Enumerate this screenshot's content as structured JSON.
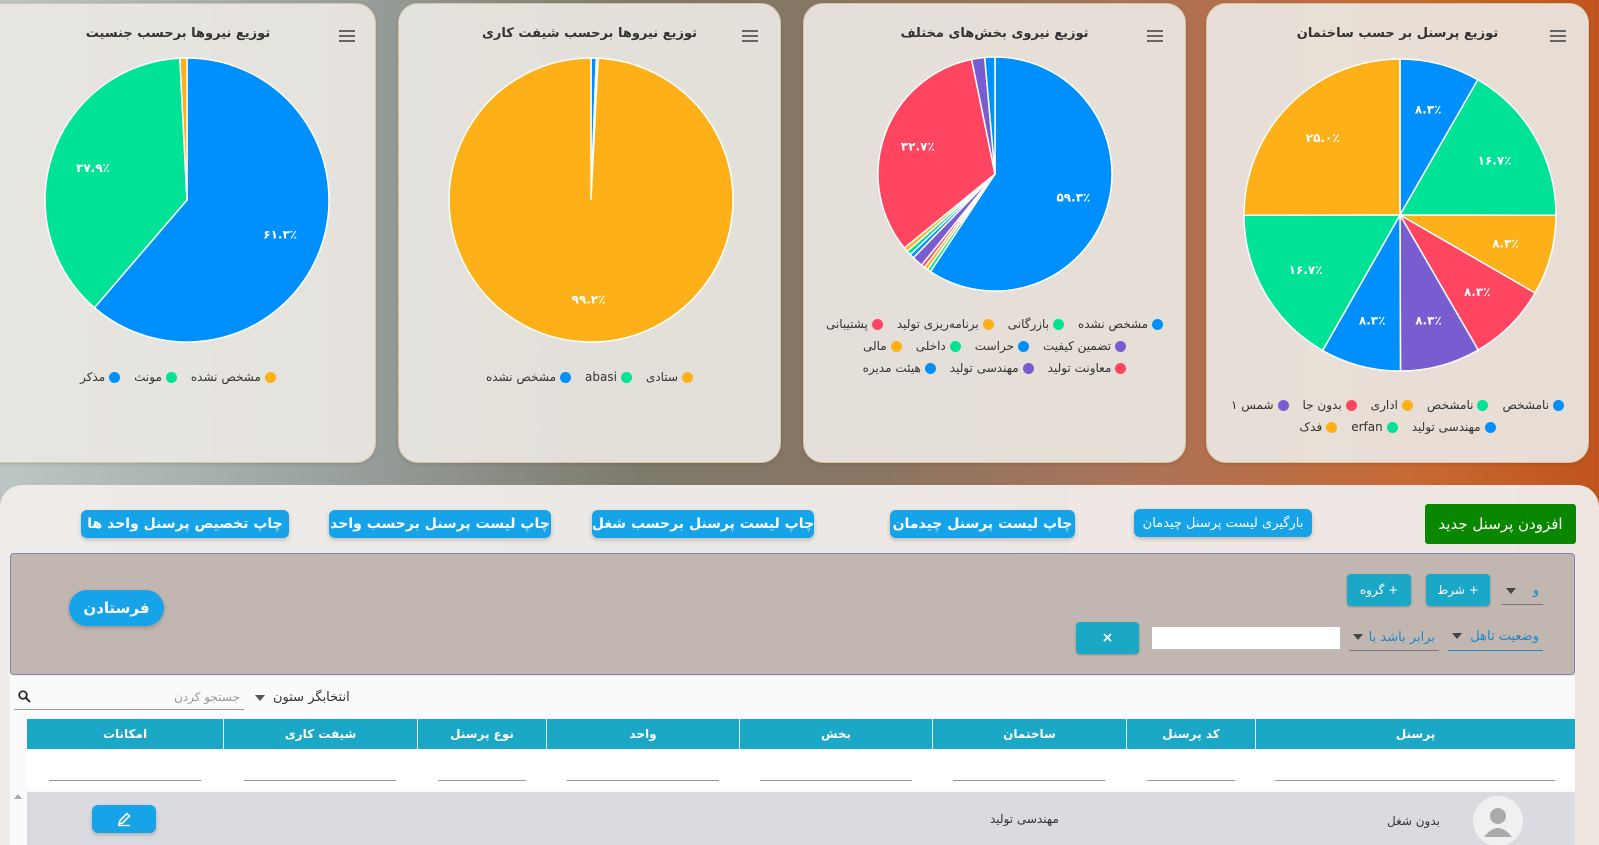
{
  "charts": [
    {
      "title": "توزیع نیروها برحسب جنسیت",
      "chart_data": {
        "type": "pie",
        "slices": [
          {
            "label": "مذکر",
            "value": 61.3,
            "color": "#0090fe",
            "text": "۶۱.۳٪"
          },
          {
            "label": "مونث",
            "value": 37.9,
            "color": "#00e396",
            "text": "۳۷.۹٪"
          },
          {
            "label": "مشخص نشده",
            "value": 0.8,
            "color": "#feb019",
            "text": ""
          }
        ]
      }
    },
    {
      "title": "توزیع نیروها برحسب شیفت کاری",
      "chart_data": {
        "type": "pie",
        "slices": [
          {
            "label": "مشخص نشده",
            "value": 0.6,
            "color": "#0090fe",
            "text": ""
          },
          {
            "label": "abasi",
            "value": 0.2,
            "color": "#00e396",
            "text": ""
          },
          {
            "label": "ستادی",
            "value": 99.2,
            "color": "#feb019",
            "text": "۹۹.۲٪"
          }
        ]
      }
    },
    {
      "title": "توزیع نیروی بخش‌های مختلف",
      "chart_data": {
        "type": "pie",
        "slices": [
          {
            "label": "مشخص نشده",
            "value": 59.3,
            "color": "#0090fe",
            "text": "۵۹.۳٪"
          },
          {
            "label": "بازرگانی",
            "value": 0.5,
            "color": "#00e396",
            "text": ""
          },
          {
            "label": "برنامه‌ریزی تولید",
            "value": 0.5,
            "color": "#feb019",
            "text": ""
          },
          {
            "label": "پشتیبانی",
            "value": 0.5,
            "color": "#ff4560",
            "text": ""
          },
          {
            "label": "تضمین کیفیت",
            "value": 1.5,
            "color": "#775dd0",
            "text": ""
          },
          {
            "label": "حراست",
            "value": 0.6,
            "color": "#0090fe",
            "text": ""
          },
          {
            "label": "داخلی",
            "value": 0.6,
            "color": "#00e396",
            "text": ""
          },
          {
            "label": "مالی",
            "value": 0.6,
            "color": "#feb019",
            "text": ""
          },
          {
            "label": "معاونت تولید",
            "value": 32.7,
            "color": "#ff4560",
            "text": "۳۲.۷٪"
          },
          {
            "label": "مهندسی تولید",
            "value": 1.8,
            "color": "#775dd0",
            "text": ""
          },
          {
            "label": "هیئت مدیره",
            "value": 1.4,
            "color": "#0090fe",
            "text": ""
          }
        ],
        "legend_rows": [
          [
            3,
            2,
            1,
            0
          ],
          [
            7,
            6,
            5,
            4
          ],
          [
            10,
            9,
            8
          ]
        ]
      }
    },
    {
      "title": "توزیع پرسنل بر حسب ساختمان",
      "chart_data": {
        "type": "pie",
        "slices": [
          {
            "label": "نامشخص",
            "value": 8.3,
            "color": "#0090fe",
            "text": "۸.۳٪"
          },
          {
            "label": "نامشخص",
            "value": 16.7,
            "color": "#00e396",
            "text": "۱۶.۷٪"
          },
          {
            "label": "اداری",
            "value": 8.3,
            "color": "#feb019",
            "text": "۸.۳٪"
          },
          {
            "label": "بدون جا",
            "value": 8.3,
            "color": "#ff4560",
            "text": "۸.۳٪"
          },
          {
            "label": "شمس ۱",
            "value": 8.3,
            "color": "#775dd0",
            "text": "۸.۳٪"
          },
          {
            "label": "مهندسی تولید",
            "value": 8.3,
            "color": "#0090fe",
            "text": "۸.۳٪"
          },
          {
            "label": "erfan",
            "value": 16.7,
            "color": "#00e396",
            "text": "۱۶.۷٪"
          },
          {
            "label": "فدک",
            "value": 25.0,
            "color": "#feb019",
            "text": "۲۵.۰٪"
          }
        ],
        "legend_rows": [
          [
            4,
            3,
            2,
            1,
            0
          ],
          [
            7,
            6,
            5
          ]
        ]
      }
    }
  ],
  "buttons": {
    "add_new": "افزودن پرسنل جدید",
    "load_list": "بارگیری لیست پرسنل چیدمان",
    "print_layout": "چاپ لیست پرسنل چیدمان",
    "print_by_job": "چاپ لیست پرسنل برحسب شغل",
    "print_by_unit": "چاپ لیست پرسنل برحسب واحد",
    "print_alloc": "چاپ تخصیص پرسنل واحد ها"
  },
  "filter": {
    "logic_value": "و",
    "add_condition": "+ شرط",
    "add_group": "+ گروه",
    "field": "وضعیت تاهل",
    "operator": "برابر باشد با",
    "remove": "×",
    "submit": "فرستادن"
  },
  "table": {
    "column_picker": "انتخابگر ستون",
    "search_placeholder": "جستجو کردن",
    "columns": [
      "پرسنل",
      "کد پرسنل",
      "ساختمان",
      "بخش",
      "واحد",
      "نوع پرسنل",
      "شیفت کاری",
      "امکانات"
    ],
    "row": {
      "personnel": "بدون شغل",
      "section": "مهندسی تولید"
    }
  }
}
